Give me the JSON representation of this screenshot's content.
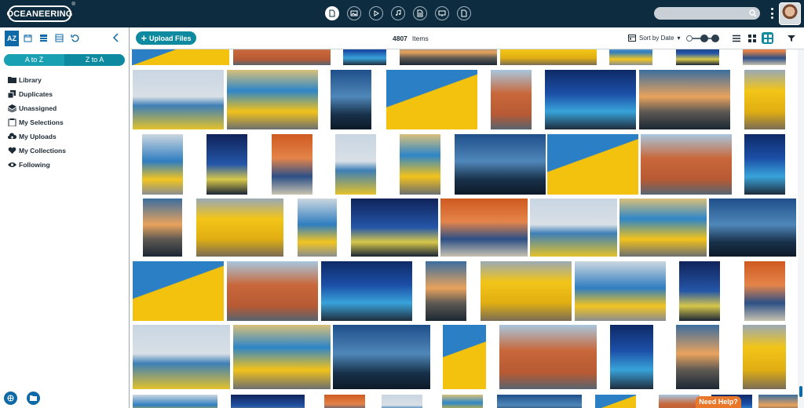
{
  "app": {
    "logo_text": "OCEANEERING",
    "logo_mark": "®"
  },
  "topnav": {
    "items": [
      "document-icon",
      "image-icon",
      "play-icon",
      "audio-icon",
      "file-text-icon",
      "presentation-icon",
      "file-icon"
    ],
    "active_index": 0
  },
  "search": {
    "value": "",
    "placeholder": ""
  },
  "sidebar": {
    "az_label": "AZ",
    "sort_options": [
      "A to Z",
      "Z to A"
    ],
    "selected_sort": "A to Z",
    "filters": [
      {
        "label": "Library",
        "icon": "folder-icon"
      },
      {
        "label": "Duplicates",
        "icon": "copy-icon"
      },
      {
        "label": "Unassigned",
        "icon": "layers-icon"
      },
      {
        "label": "My Selections",
        "icon": "clipboard-icon"
      },
      {
        "label": "My Uploads",
        "icon": "cloud-upload-icon"
      },
      {
        "label": "My Collections",
        "icon": "heart-icon"
      },
      {
        "label": "Following",
        "icon": "eye-icon"
      }
    ]
  },
  "toolbar": {
    "upload_label": "Upload Files",
    "item_count": "4807",
    "items_label": "Items",
    "sort_label": "Sort by Date",
    "view_modes": [
      "list-icon",
      "grid-icon",
      "large-grid-icon"
    ],
    "active_view": 2
  },
  "help_label": "Need Help?",
  "colors": {
    "topbar": "#0d2c3f",
    "accent": "#0e8aa0",
    "primary": "#0d6aa6",
    "help": "#e8772a"
  }
}
